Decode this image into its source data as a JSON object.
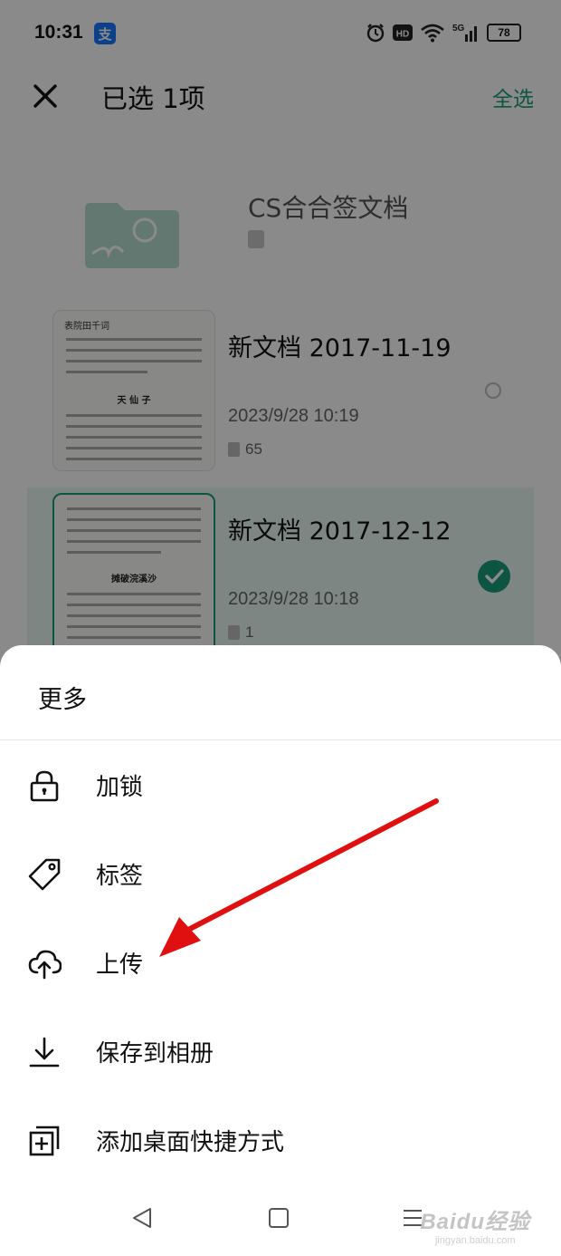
{
  "status_bar": {
    "time": "10:31",
    "icons": [
      "alipay-icon",
      "alarm-icon",
      "hd-icon",
      "wifi-icon",
      "signal-5g-icon"
    ],
    "network": "5G",
    "battery": "78"
  },
  "header": {
    "title": "已选 1项",
    "select_all": "全选"
  },
  "list": {
    "folder": {
      "name": "CS合合签文档"
    },
    "documents": [
      {
        "name": "新文档 2017-11-19",
        "date": "2023/9/28 10:19",
        "pages": "65",
        "selected": false,
        "thumb_heading": "表院田千词",
        "thumb_title": "天 仙 子"
      },
      {
        "name": "新文档 2017-12-12",
        "date": "2023/9/28 10:18",
        "pages": "1",
        "selected": true,
        "thumb_heading": "",
        "thumb_title": "摊破浣溪沙"
      }
    ]
  },
  "sheet": {
    "title": "更多",
    "items": [
      {
        "label": "加锁",
        "icon": "lock-icon"
      },
      {
        "label": "标签",
        "icon": "tag-icon"
      },
      {
        "label": "上传",
        "icon": "cloud-upload-icon"
      },
      {
        "label": "保存到相册",
        "icon": "download-icon"
      },
      {
        "label": "添加桌面快捷方式",
        "icon": "add-shortcut-icon"
      }
    ]
  },
  "nav_bar": {
    "icons": [
      "back-icon",
      "home-icon",
      "menu-icon"
    ]
  },
  "watermark": {
    "main": "Baidu经验",
    "sub": "jingyan.baidu.com"
  },
  "colors": {
    "accent": "#1a9b7a",
    "annotation_arrow": "#e01010",
    "overlay": "rgba(0,0,0,0.46)"
  }
}
